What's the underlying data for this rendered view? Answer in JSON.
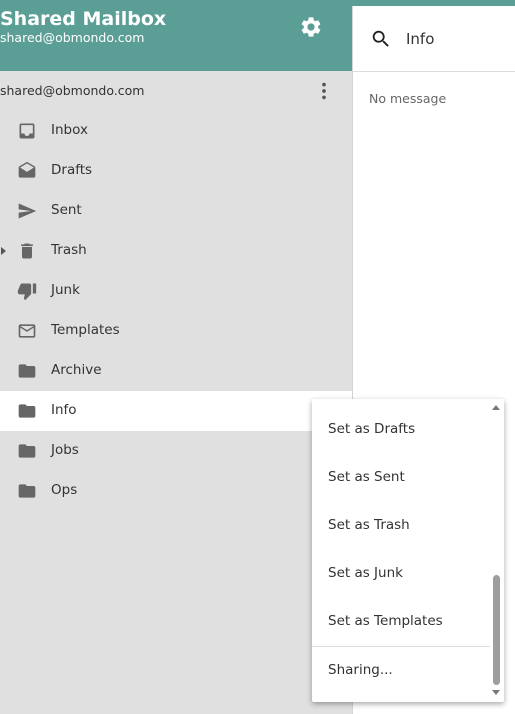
{
  "colors": {
    "accent": "#5a9e96",
    "sidebar_bg": "#e0e0e0",
    "selected_bg": "#ffffff",
    "icon": "#666666"
  },
  "header": {
    "title": "Shared Mailbox",
    "email": "shared@obmondo.com",
    "settings_icon": "gear-icon"
  },
  "account": {
    "name": "shared@obmondo.com",
    "menu_icon": "kebab-icon"
  },
  "folders": [
    {
      "label": "Inbox",
      "icon": "inbox-icon"
    },
    {
      "label": "Drafts",
      "icon": "drafts-icon"
    },
    {
      "label": "Sent",
      "icon": "send-icon"
    },
    {
      "label": "Trash",
      "icon": "trash-icon"
    },
    {
      "label": "Junk",
      "icon": "thumbs-down-icon"
    },
    {
      "label": "Templates",
      "icon": "envelope-icon"
    },
    {
      "label": "Archive",
      "icon": "folder-icon"
    },
    {
      "label": "Info",
      "icon": "folder-icon",
      "selected": true
    },
    {
      "label": "Jobs",
      "icon": "folder-icon"
    },
    {
      "label": "Ops",
      "icon": "folder-icon"
    }
  ],
  "search": {
    "value": "Info"
  },
  "message_pane": {
    "empty_text": "No message"
  },
  "context_menu": {
    "items": [
      "Set as Drafts",
      "Set as Sent",
      "Set as Trash",
      "Set as Junk",
      "Set as Templates"
    ],
    "sharing": "Sharing..."
  }
}
